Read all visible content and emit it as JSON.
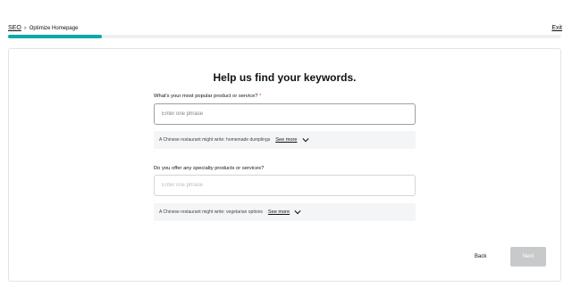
{
  "header": {
    "breadcrumb_root": "SEO",
    "breadcrumb_separator": ">",
    "breadcrumb_current": "Optimize Homepage",
    "exit_label": "Exit",
    "progress_fraction": 0.17
  },
  "main": {
    "title": "Help us find your keywords.",
    "questions": [
      {
        "label": "What's your most popular product or service?",
        "required_mark": "*",
        "placeholder": "Enter one phrase",
        "hint_text": "A Chinese restaurant might write: homemade dumplings",
        "see_more_label": "See more"
      },
      {
        "label": "Do you offer any specialty products or services?",
        "placeholder": "Enter one phrase",
        "hint_text": "A Chinese restaurant might write: vegetarian options",
        "see_more_label": "See more"
      }
    ]
  },
  "footer": {
    "back_label": "Back",
    "next_label": "Next"
  },
  "colors": {
    "accent": "#0aa8a7",
    "progress_track": "#eef1f3",
    "required": "#e23b3b",
    "next_disabled": "#c7c9cb",
    "hint_bg": "#f4f5f6"
  },
  "icons": {
    "chevron": "chevron-down-icon"
  }
}
